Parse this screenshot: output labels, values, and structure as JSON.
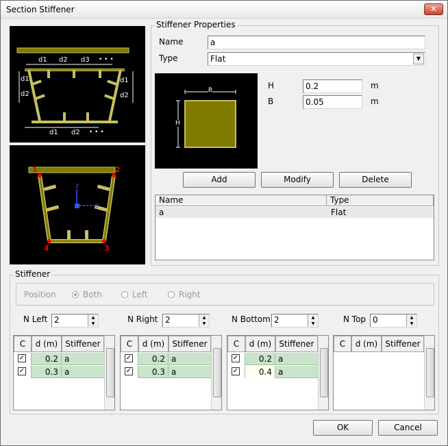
{
  "window": {
    "title": "Section Stiffener",
    "close_label": "✕"
  },
  "diagrams": {
    "top": {
      "d1": "d1",
      "d2": "d2",
      "d3": "d3",
      "more": "• • •"
    },
    "bottom": {
      "p1": "1",
      "p2": "2",
      "p3": "3",
      "p4": "4",
      "z": "z",
      "y": "y"
    }
  },
  "props": {
    "group_label": "Stiffener Properties",
    "name_label": "Name",
    "name_value": "a",
    "type_label": "Type",
    "type_value": "Flat",
    "preview_b": "B",
    "preview_h": "H",
    "h_label": "H",
    "h_value": "0.2",
    "h_unit": "m",
    "b_label": "B",
    "b_value": "0.05",
    "b_unit": "m",
    "add_label": "Add",
    "modify_label": "Modify",
    "delete_label": "Delete",
    "list": {
      "columns": [
        "Name",
        "Type"
      ],
      "rows": [
        {
          "name": "a",
          "type": "Flat"
        }
      ]
    }
  },
  "stiffener": {
    "group_label": "Stiffener",
    "position_label": "Position",
    "position_options": [
      "Both",
      "Left",
      "Right"
    ],
    "n_left_label": "N Left",
    "n_left_value": "2",
    "n_right_label": "N Right",
    "n_right_value": "2",
    "n_bottom_label": "N Bottom",
    "n_bottom_value": "2",
    "n_top_label": "N Top",
    "n_top_value": "0",
    "grid_columns": [
      "C",
      "d (m)",
      "Stiffener"
    ],
    "grids": {
      "left": [
        {
          "checked": "✓",
          "d": "0.2",
          "stiffener": "a"
        },
        {
          "checked": "✓",
          "d": "0.3",
          "stiffener": "a"
        }
      ],
      "right": [
        {
          "checked": "✓",
          "d": "0.2",
          "stiffener": "a"
        },
        {
          "checked": "✓",
          "d": "0.3",
          "stiffener": "a"
        }
      ],
      "bottom": [
        {
          "checked": "✓",
          "d": "0.2",
          "stiffener": "a"
        },
        {
          "checked": "✓",
          "d": "0.4",
          "stiffener": "a"
        }
      ],
      "top": []
    }
  },
  "footer": {
    "ok_label": "OK",
    "cancel_label": "Cancel"
  },
  "colors": {
    "olive": "#7f7a00",
    "olive_light": "#c8c060",
    "grid_row": "#c9e4c9"
  }
}
